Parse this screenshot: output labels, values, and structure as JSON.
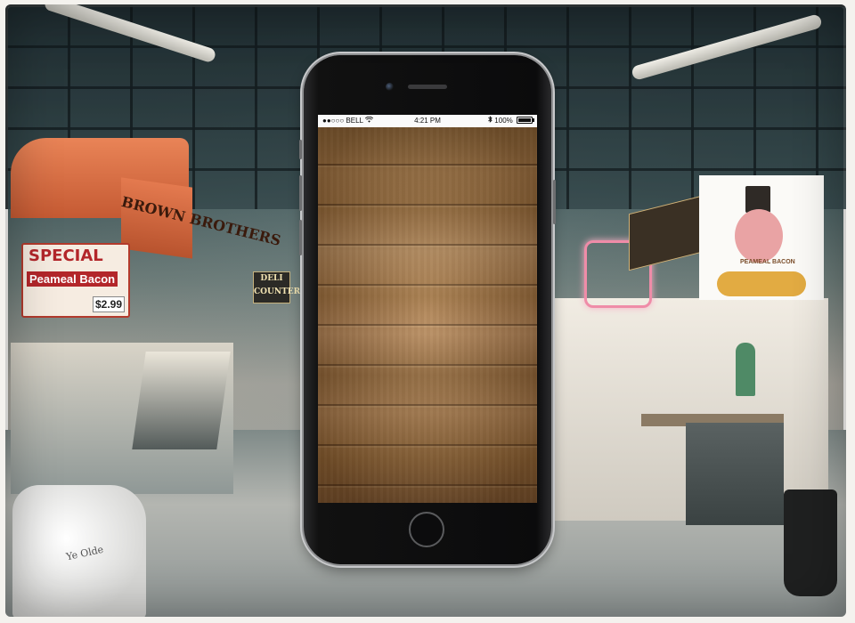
{
  "background": {
    "left_stall_sign": "BROWN BROTHERS",
    "special_sign": {
      "headline": "SPECIAL",
      "product": "Peameal Bacon",
      "price": "$2.99"
    },
    "deli_sign_lines": [
      "DELI",
      "COUNTER"
    ],
    "pig_sign_caption": "PEAMEAL BACON",
    "bag_text": "Ye Olde"
  },
  "phone": {
    "status_bar": {
      "carrier": "BELL",
      "signal_dots": "●●○○○",
      "time": "4:21 PM",
      "battery": "100%",
      "bluetooth_icon": "bluetooth-icon",
      "wifi_icon": "wifi-icon"
    },
    "screen_content": "wood-texture"
  },
  "colors": {
    "phone_body": "#0b0b0c",
    "phone_bezel": "#c8c9cb",
    "status_bar_bg": "#fafafa",
    "wood_base": "#a67a48"
  }
}
